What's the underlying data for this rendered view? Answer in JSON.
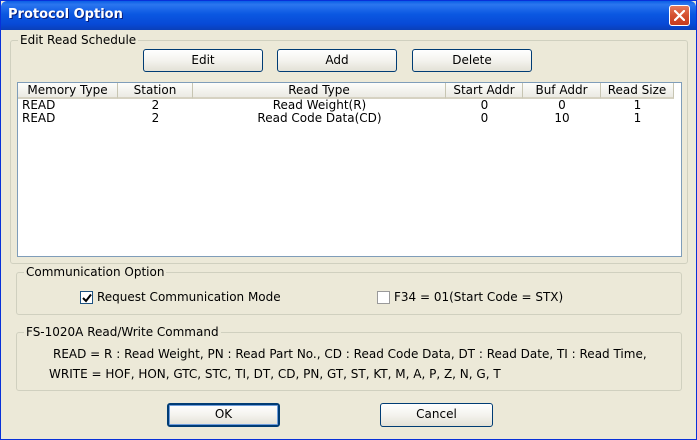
{
  "window": {
    "title": "Protocol Option"
  },
  "schedule": {
    "group_label": "Edit Read Schedule",
    "edit_label": "Edit",
    "add_label": "Add",
    "delete_label": "Delete",
    "columns": [
      "Memory Type",
      "Station",
      "Read Type",
      "Start Addr",
      "Buf Addr",
      "Read Size"
    ],
    "rows": [
      [
        "READ",
        "2",
        "Read Weight(R)",
        "0",
        "0",
        "1"
      ],
      [
        "READ",
        "2",
        "Read Code Data(CD)",
        "0",
        "10",
        "1"
      ]
    ]
  },
  "comm": {
    "group_label": "Communication Option",
    "request_mode_label": "Request Communication Mode",
    "request_mode_checked": true,
    "f34_label": "F34 = 01(Start Code = STX)",
    "f34_checked": false
  },
  "command": {
    "group_label": "FS-1020A Read/Write Command",
    "read_line": "READ = R : Read Weight, PN : Read Part No., CD : Read Code Data, DT : Read Date, TI : Read Time,",
    "write_line": "WRITE = HOF, HON, GTC, STC, TI, DT, CD, PN, GT, ST, KT, M, A, P, Z, N, G, T"
  },
  "footer": {
    "ok_label": "OK",
    "cancel_label": "Cancel"
  }
}
